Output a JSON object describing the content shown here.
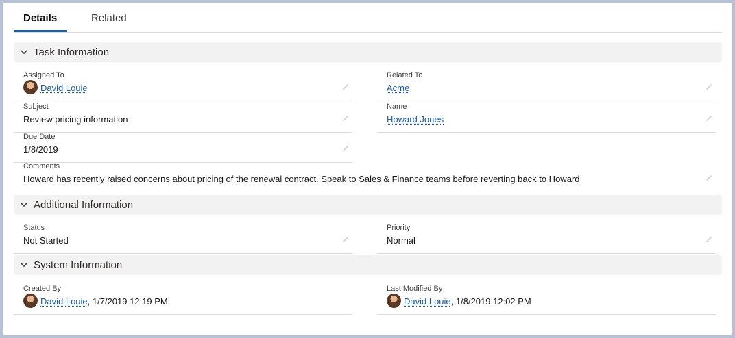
{
  "tabs": [
    {
      "label": "Details"
    },
    {
      "label": "Related"
    }
  ],
  "sections": {
    "task": {
      "title": "Task Information",
      "assigned_to": {
        "label": "Assigned To",
        "value": "David Louie"
      },
      "related_to": {
        "label": "Related To",
        "value": "Acme"
      },
      "subject": {
        "label": "Subject",
        "value": "Review pricing information"
      },
      "name": {
        "label": "Name",
        "value": "Howard Jones"
      },
      "due_date": {
        "label": "Due Date",
        "value": "1/8/2019"
      },
      "comments": {
        "label": "Comments",
        "value": "Howard has recently raised concerns about pricing of the renewal contract. Speak to Sales & Finance teams before reverting back to Howard"
      }
    },
    "additional": {
      "title": "Additional Information",
      "status": {
        "label": "Status",
        "value": "Not Started"
      },
      "priority": {
        "label": "Priority",
        "value": "Normal"
      }
    },
    "system": {
      "title": "System Information",
      "created_by": {
        "label": "Created By",
        "user": "David Louie",
        "timestamp": ", 1/7/2019 12:19 PM"
      },
      "last_modified_by": {
        "label": "Last Modified By",
        "user": "David Louie",
        "timestamp": ", 1/8/2019 12:02 PM"
      }
    }
  },
  "icons": {
    "chevron": "chevron-down-icon",
    "edit": "pencil-icon"
  },
  "colors": {
    "link": "#1b5ca8",
    "section_bg": "#f3f2f2",
    "tab_accent": "#1b5ca8"
  }
}
